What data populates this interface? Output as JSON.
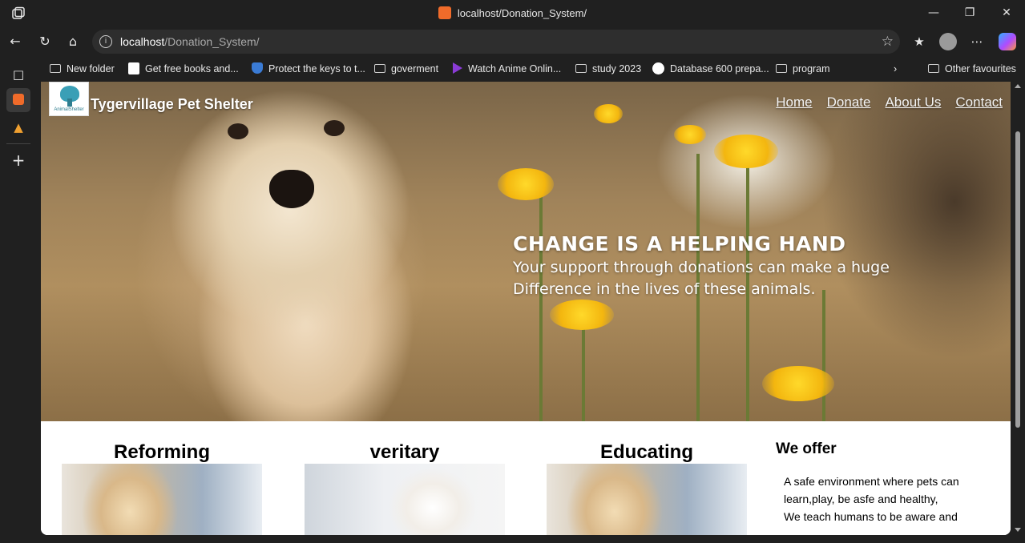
{
  "window": {
    "title": "localhost/Donation_System/"
  },
  "address_bar": {
    "url_host": "localhost",
    "url_path": "/Donation_System/"
  },
  "bookmarks": [
    {
      "label": "New folder",
      "icon": "folder-icon"
    },
    {
      "label": "Get free books and...",
      "icon": "page-icon"
    },
    {
      "label": "Protect the keys to t...",
      "icon": "shield-icon"
    },
    {
      "label": "goverment",
      "icon": "folder-icon"
    },
    {
      "label": "Watch Anime Onlin...",
      "icon": "play-icon"
    },
    {
      "label": "study 2023",
      "icon": "folder-icon"
    },
    {
      "label": "Database 600 prepa...",
      "icon": "disc-icon"
    },
    {
      "label": "program",
      "icon": "folder-icon"
    }
  ],
  "other_favourites": "Other favourites",
  "site": {
    "logo_text": "AnimalShelter",
    "title": "Tygervillage Pet Shelter",
    "nav": [
      "Home",
      "Donate",
      "About Us",
      "Contact"
    ],
    "hero_heading": "CHANGE IS A HELPING HAND",
    "hero_line1": "Your support through donations can make a huge",
    "hero_line2": "Difference in the lives of these animals.",
    "cards": [
      {
        "title": "Reforming"
      },
      {
        "title": "veritary"
      },
      {
        "title": "Educating"
      }
    ],
    "offer": {
      "title": "We offer",
      "line1": "A safe environment where pets can",
      "line2": "learn,play, be asfe and healthy,",
      "line3": "We teach humans to be aware and"
    }
  },
  "colors": {
    "browser_chrome": "#202020",
    "xampp_orange": "#f06b2a"
  }
}
